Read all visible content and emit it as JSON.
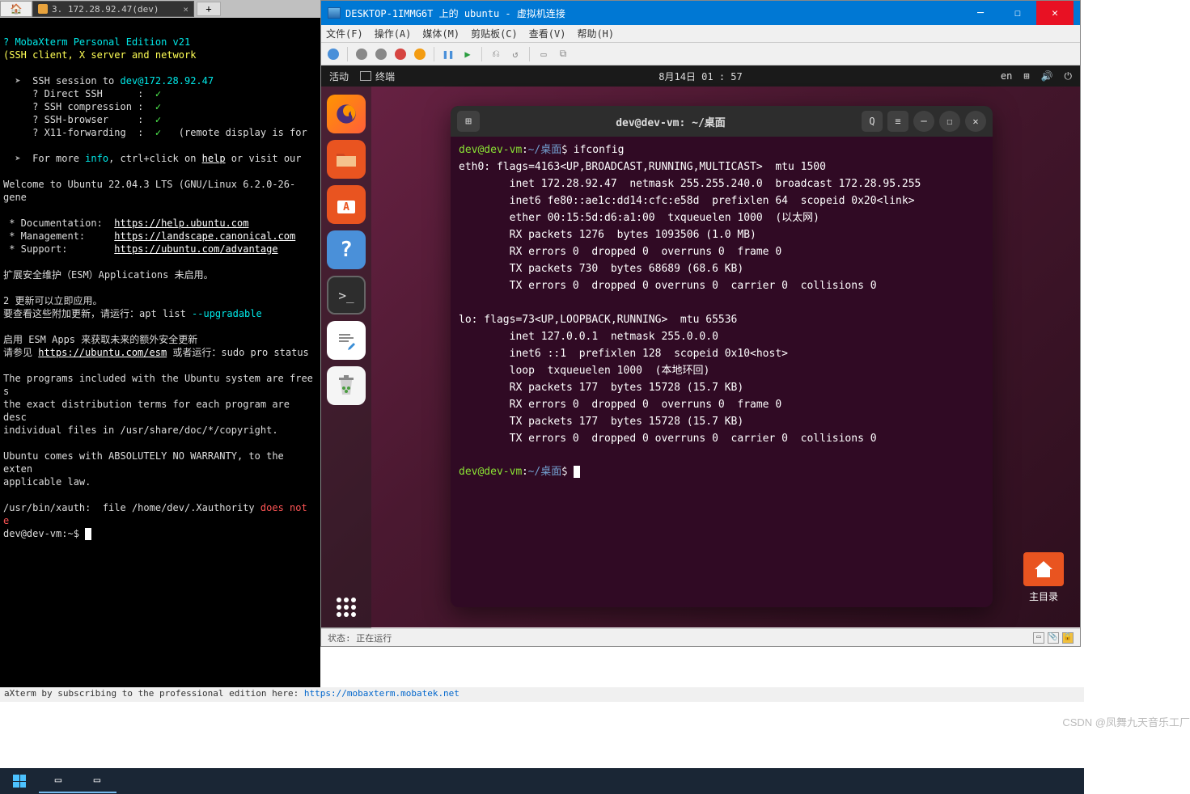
{
  "moba": {
    "tab_title": "3. 172.28.92.47(dev)",
    "version_line1": "? MobaXterm Personal Edition v21",
    "version_line2": "(SSH client, X server and network ",
    "ssh_session": "SSH session to ",
    "ssh_target": "dev@172.28.92.47",
    "direct_ssh": "? Direct SSH      :  ",
    "ssh_comp": "? SSH compression :  ",
    "ssh_browser": "? SSH-browser     :  ",
    "x11": "? X11-forwarding  :  ",
    "x11_note": "(remote display is for",
    "more_info": "For more ",
    "info": "info",
    "ctrl_click": ", ctrl+click on ",
    "help": "help",
    "visit": " or visit our",
    "welcome": "Welcome to Ubuntu 22.04.3 LTS (GNU/Linux 6.2.0-26-gene",
    "doc": " * Documentation:  ",
    "doc_url": "https://help.ubuntu.com",
    "mgmt": " * Management:     ",
    "mgmt_url": "https://landscape.canonical.com",
    "sup": " * Support:        ",
    "sup_url": "https://ubuntu.com/advantage",
    "esm1": "扩展安全维护（ESM）Applications 未启用。",
    "upd1": "2 更新可以立即应用。",
    "upd2": "要查看这些附加更新，请运行：apt list ",
    "upgradable": "--upgradable",
    "esm2": "启用 ESM Apps 来获取未来的额外安全更新",
    "esm3": "请参见 ",
    "esm_url": "https://ubuntu.com/esm",
    "esm4": " 或者运行：sudo pro status",
    "prog1": "The programs included with the Ubuntu system are free s",
    "prog2": "the exact distribution terms for each program are desc",
    "prog3": "individual files in /usr/share/doc/*/copyright.",
    "warr1": "Ubuntu comes with ABSOLUTELY NO WARRANTY, to the exten",
    "warr2": "applicable law.",
    "xauth": "/usr/bin/xauth:  file /home/dev/.Xauthority ",
    "xauth_err": "does not e",
    "prompt": "dev@dev-vm:~$ ",
    "footer": "aXterm by subscribing to the professional edition here:  ",
    "footer_url": "https://mobaxterm.mobatek.net"
  },
  "vmc": {
    "title": "DESKTOP-1IMMG6T 上的 ubuntu - 虚拟机连接",
    "menu": {
      "file": "文件(F)",
      "action": "操作(A)",
      "media": "媒体(M)",
      "clip": "剪贴板(C)",
      "view": "查看(V)",
      "help": "帮助(H)"
    },
    "status": "状态: 正在运行"
  },
  "ubuntu": {
    "activities": "活动",
    "terminal_name": "终端",
    "datetime": "8月14日  01 : 57",
    "lang": "en",
    "term_title": "dev@dev-vm: ~/桌面",
    "home_label": "主目录",
    "prompt_user": "dev@dev-vm",
    "prompt_path": "~/桌面",
    "cmd1": "ifconfig",
    "out": [
      "eth0: flags=4163<UP,BROADCAST,RUNNING,MULTICAST>  mtu 1500",
      "        inet 172.28.92.47  netmask 255.255.240.0  broadcast 172.28.95.255",
      "        inet6 fe80::ae1c:dd14:cfc:e58d  prefixlen 64  scopeid 0x20<link>",
      "        ether 00:15:5d:d6:a1:00  txqueuelen 1000  (以太网)",
      "        RX packets 1276  bytes 1093506 (1.0 MB)",
      "        RX errors 0  dropped 0  overruns 0  frame 0",
      "        TX packets 730  bytes 68689 (68.6 KB)",
      "        TX errors 0  dropped 0 overruns 0  carrier 0  collisions 0",
      "",
      "lo: flags=73<UP,LOOPBACK,RUNNING>  mtu 65536",
      "        inet 127.0.0.1  netmask 255.0.0.0",
      "        inet6 ::1  prefixlen 128  scopeid 0x10<host>",
      "        loop  txqueuelen 1000  (本地环回)",
      "        RX packets 177  bytes 15728 (15.7 KB)",
      "        RX errors 0  dropped 0  overruns 0  frame 0",
      "        TX packets 177  bytes 15728 (15.7 KB)",
      "        TX errors 0  dropped 0 overruns 0  carrier 0  collisions 0"
    ]
  },
  "csdn": "CSDN @凤舞九天音乐工厂"
}
